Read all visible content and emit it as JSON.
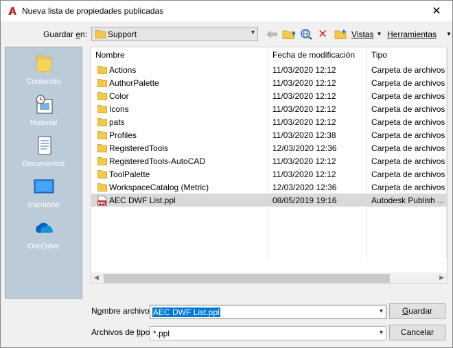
{
  "window": {
    "title": "Nueva lista de propiedades publicadas"
  },
  "toolbar": {
    "save_in_label_pre": "Guardar ",
    "save_in_label_key": "e",
    "save_in_label_post": "n:",
    "location": "Support",
    "views_label": "Vistas",
    "tools_label": "Herramientas"
  },
  "places": [
    {
      "label": "Contenido",
      "icon": "folder-icon"
    },
    {
      "label": "Historial",
      "icon": "history-icon"
    },
    {
      "label": "Documentos",
      "icon": "documents-icon"
    },
    {
      "label": "Escritorio",
      "icon": "desktop-icon"
    },
    {
      "label": "OneDrive",
      "icon": "onedrive-icon"
    }
  ],
  "columns": {
    "name": "Nombre",
    "date": "Fecha de modificación",
    "type": "Tipo"
  },
  "files": [
    {
      "name": "Actions",
      "date": "11/03/2020 12:12",
      "type": "Carpeta de archivos",
      "icon": "folder-icon"
    },
    {
      "name": "AuthorPalette",
      "date": "11/03/2020 12:12",
      "type": "Carpeta de archivos",
      "icon": "folder-icon"
    },
    {
      "name": "Color",
      "date": "11/03/2020 12:12",
      "type": "Carpeta de archivos",
      "icon": "folder-icon"
    },
    {
      "name": "Icons",
      "date": "11/03/2020 12:12",
      "type": "Carpeta de archivos",
      "icon": "folder-icon"
    },
    {
      "name": "pats",
      "date": "11/03/2020 12:12",
      "type": "Carpeta de archivos",
      "icon": "folder-icon"
    },
    {
      "name": "Profiles",
      "date": "11/03/2020 12:38",
      "type": "Carpeta de archivos",
      "icon": "folder-icon"
    },
    {
      "name": "RegisteredTools",
      "date": "12/03/2020 12:36",
      "type": "Carpeta de archivos",
      "icon": "folder-icon"
    },
    {
      "name": "RegisteredTools-AutoCAD",
      "date": "11/03/2020 12:12",
      "type": "Carpeta de archivos",
      "icon": "folder-icon"
    },
    {
      "name": "ToolPalette",
      "date": "11/03/2020 12:12",
      "type": "Carpeta de archivos",
      "icon": "folder-icon"
    },
    {
      "name": "WorkspaceCatalog (Metric)",
      "date": "12/03/2020 12:36",
      "type": "Carpeta de archivos",
      "icon": "folder-icon"
    },
    {
      "name": "AEC DWF List.ppl",
      "date": "08/05/2019 19:16",
      "type": "Autodesk Publish ...",
      "icon": "ppl-file-icon",
      "selected": true
    }
  ],
  "file_icon_text": "PPL",
  "filename": {
    "label_pre": "N",
    "label_key": "o",
    "label_post": "mbre archivo:",
    "value": "AEC DWF List.ppl"
  },
  "filetype": {
    "label_pre": "Archivos de ",
    "label_key": "t",
    "label_post": "ipo:",
    "value": "*.ppl"
  },
  "buttons": {
    "save_pre": "",
    "save_key": "G",
    "save_post": "uardar",
    "cancel": "Cancelar"
  },
  "colors": {
    "accent": "#0078d7",
    "places_bg": "#bccbd8",
    "folder": "#f2c94c",
    "delete": "#d32f2f",
    "autocad_red": "#c62828"
  }
}
